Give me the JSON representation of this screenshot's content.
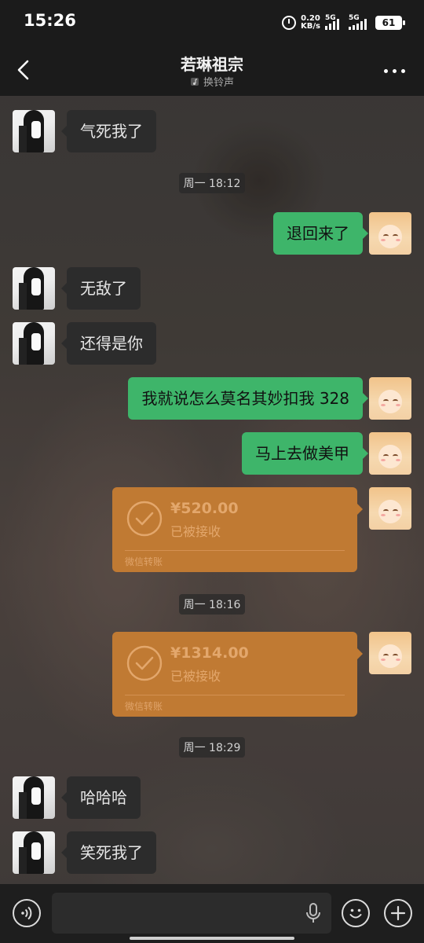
{
  "status_bar": {
    "time": "15:26",
    "net_speed_value": "0.20",
    "net_speed_unit": "KB/s",
    "signal_1": "5G",
    "signal_2": "5G",
    "battery": "61"
  },
  "header": {
    "title": "若琳祖宗",
    "subtitle": "换铃声",
    "back_icon": "chevron-left-icon",
    "more_icon": "more-dots-icon"
  },
  "messages": {
    "m1": "气死我了",
    "ts1": "周一 18:12",
    "m2": "退回来了",
    "m3": "无敌了",
    "m4": "还得是你",
    "m5": "我就说怎么莫名其妙扣我 328",
    "m6": "马上去做美甲",
    "t1": {
      "amount": "¥520.00",
      "status": "已被接收",
      "source": "微信转账"
    },
    "ts2": "周一 18:16",
    "t2": {
      "amount": "¥1314.00",
      "status": "已被接收",
      "source": "微信转账"
    },
    "ts3": "周一 18:29",
    "m7": "哈哈哈",
    "m8": "笑死我了"
  },
  "input_bar": {
    "voice_icon": "voice-icon",
    "mic_icon": "mic-icon",
    "emoji_icon": "emoji-icon",
    "plus_icon": "plus-icon"
  },
  "colors": {
    "sent_bubble": "#3eb56a",
    "received_bubble": "#2c2c2c",
    "transfer_card": "#c07a33",
    "bar_bg": "#1b1b1b"
  }
}
